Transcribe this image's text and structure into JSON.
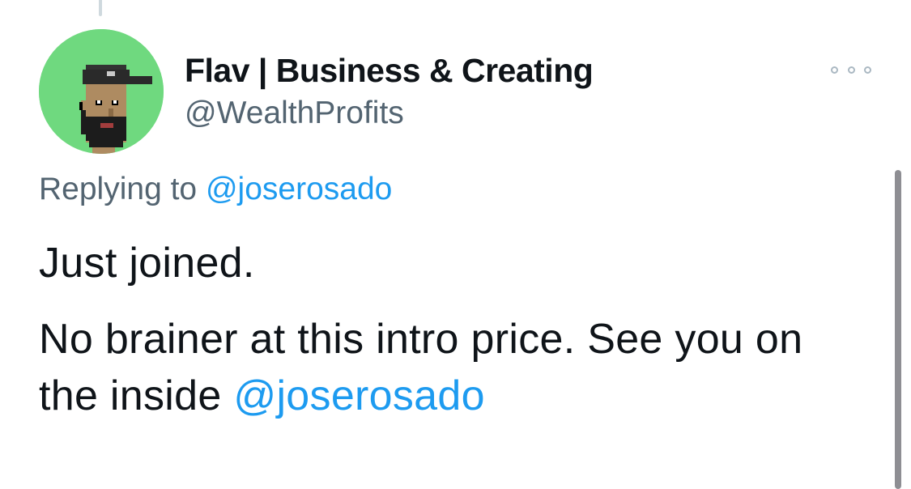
{
  "tweet": {
    "author": {
      "display_name": "Flav | Business & Creating",
      "handle": "@WealthProfits",
      "avatar_icon": "pixel-punk-avatar",
      "avatar_bg": "#6fd97f"
    },
    "more_icon": "ellipsis-icon",
    "replying_prefix": "Replying to",
    "replying_mention": "@joserosado",
    "paragraph_1": "Just joined.",
    "paragraph_2_text": "No brainer at this intro price. See you on the inside",
    "paragraph_2_mention": "@joserosado"
  },
  "colors": {
    "text": "#0f1419",
    "secondary_text": "#536471",
    "link": "#1d9bf0"
  }
}
